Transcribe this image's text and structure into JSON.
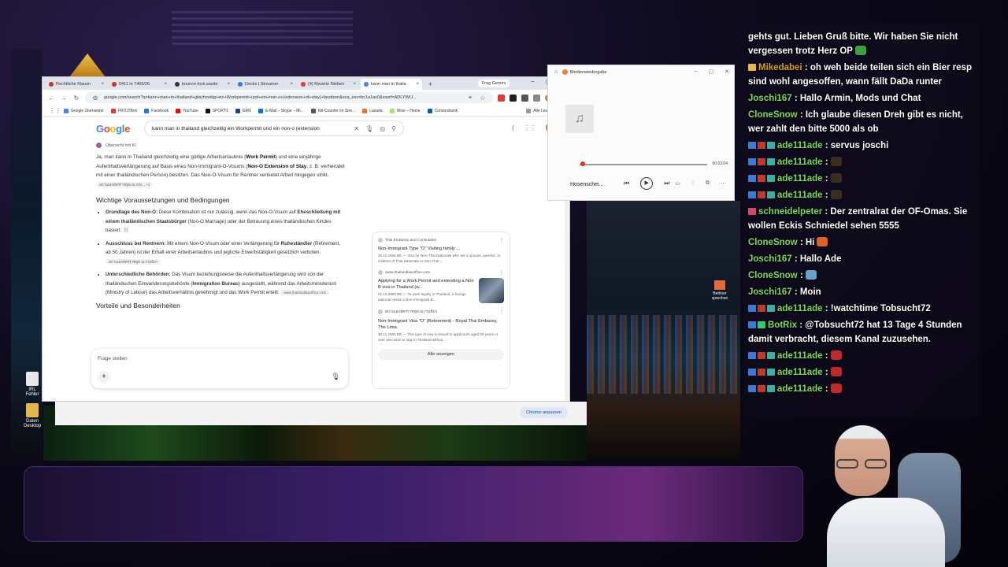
{
  "browser": {
    "tabs": [
      {
        "label": "Rechtliche Klausn",
        "color": "#c0392b"
      },
      {
        "label": "0411 in 7465/26",
        "color": "#d93025"
      },
      {
        "label": "bounce-lock.waste",
        "color": "#333333"
      },
      {
        "label": "Decks | Streamer",
        "color": "#3a7bd5"
      },
      {
        "label": "(4) Reverie Nieben",
        "color": "#e53935"
      },
      {
        "label": "kann man in thaila",
        "color": "#4285f4",
        "active": true
      }
    ],
    "gemini_label": "Frag Gemini",
    "url": "google.com/search?q=kann+man+in+thailand+gleichzeitig+ein+Workpermit+und+ein+non-o+(extension+of+stay)+besitzen&sca_esv=bc1a1ac0&sxsrf=ADLYWIJ...",
    "bookmarks": [
      {
        "label": "Google Übersetzer",
        "color": "#4285f4"
      },
      {
        "label": "FRITZ!Box",
        "color": "#e53935"
      },
      {
        "label": "Facebook",
        "color": "#1877f2"
      },
      {
        "label": "YouTube",
        "color": "#ff0000"
      },
      {
        "label": "SPORT1",
        "color": "#111111"
      },
      {
        "label": "GMX",
        "color": "#1c449b"
      },
      {
        "label": "E-Mail – Skype – Mi...",
        "color": "#0078d4"
      },
      {
        "label": "Kill-Counter im Stre...",
        "color": "#555555"
      },
      {
        "label": "Lazada",
        "color": "#f57224"
      },
      {
        "label": "Wise – Home",
        "color": "#9fe870"
      },
      {
        "label": "Consorsbank",
        "color": "#0064b0"
      },
      {
        "label": "Alle Lesezeichen",
        "color": "#999999"
      }
    ],
    "search_query": "kann man in thailand gleichzeitig ein Workpermit und ein non-o (extension",
    "ai_overview_label": "Übersicht mit KI",
    "intro": {
      "p1": "Ja, man kann in Thailand gleichzeitig eine gültige Arbeitserlaubnis (",
      "b1": "Work Permit",
      "p2": ") und eine einjährige Aufenthaltsverlängerung auf Basis eines Non-Immigrant-O-Visums (",
      "b2": "Non-O Extension of Stay",
      "p3": ", z. B. verheiratet mit einer thailändischen Person) besitzen. Das Non-O-Visum für Rentner verbietet Arbeit hingegen strikt.",
      "chip": "สถานเอกอัครราชทูต ณ กรุง... +1"
    },
    "heading_conditions": "Wichtige Voraussetzungen und Bedingungen",
    "points": [
      {
        "bold": "Grundlage des Non-O:",
        "t1": " Diese Kombination ist nur zulässig, wenn das Non-O-Visum auf ",
        "b2": "Eheschließung mit einem thailändischen Staatsbürger",
        "t2": " (Non-O Marriage) oder der Betreuung eines thailändischen Kindes basiert.",
        "chip": ""
      },
      {
        "bold": "Ausschluss bei Rentnern:",
        "t1": " Mit einem Non-O-Visum oder einer Verlängerung für ",
        "b2": "Ruheständler",
        "t2": " (Retirement, ab 50 Jahren) ist der Erhalt einer Arbeitserlaubnis und jegliche Erwerbstätigkeit gesetzlich verboten.",
        "chip": "สถานเอกอัครราชทูต ณ กรุงลิมา"
      },
      {
        "bold": "Unterschiedliche Behörden:",
        "t1": " Das Visum beziehungsweise die Aufenthaltsverlängerung wird von der thailändischen Einwanderungsbehörde (",
        "b2": "Immigration Bureau",
        "t2": ") ausgestellt, während das Arbeitsministerium (Ministry of Labour) das Arbeitsverhältnis genehmigt und das Work Permit erteilt.",
        "chip": "www.thailandlawoffice.com"
      }
    ],
    "heading_advantages": "Vorteile und Besonderheiten",
    "ask_placeholder": "Frage stellen",
    "sources": [
      {
        "site": "Thai Embassy and Consulates",
        "title": "Non-Immigrant Type \"O\" Visiting family ...",
        "snippet": "30.11.2566 BE — Visa for Non-Thai Nationals who are a spouse, parents, or children of Thai Nationals or Non-Thai ..."
      },
      {
        "site": "www.thailandlawoffice.com",
        "title": "Applying for a Work Permit and extending a Non B visa in Thailand (w...",
        "snippet": "01.10.2568 BE — To work legally in Thailand, a foreign national needs a Non-Immigrant B..."
      },
      {
        "site": "สถานเอกอัครราชทูต ณ กรุงลิมา",
        "title": "Non-Immigrant Visa \"O\" (Retirement) - Royal Thai Embassy, The Lima.",
        "snippet": "30.11.2565 BE — This type of visa is issued to applicants aged 50 years or over who wish to stay in Thailand withou..."
      }
    ],
    "sources_all": "Alle anzeigen",
    "chrome_customize": "Chrome anpassen"
  },
  "media_player": {
    "title": "Medienwiedergabe",
    "time": "00:03:04",
    "song": "Hosenschei...",
    "progress": 0.02
  },
  "desktop": {
    "icons": [
      {
        "label": "IRL Fehler"
      },
      {
        "label": "Daten Desktop"
      }
    ],
    "berliner": "Berliner sprechen"
  },
  "chat": {
    "messages": [
      {
        "user": "",
        "text": "gehts gut. Lieben Gruß bitte. Wir haben Sie nicht vergessen trotz Herz OP",
        "color": "#ffffff",
        "badges": [],
        "emote": "#3aa040"
      },
      {
        "user": "Mikedabei",
        "text": ": oh weh beide teilen sich ein Bier resp sind wohl angesoffen, wann fällt DaDa runter",
        "color": "#d4a017",
        "badges": [
          "#e6b84a"
        ],
        "emote": ""
      },
      {
        "user": "Joschi167",
        "text": ": Hallo Armin, Mods und Chat",
        "color": "#7ed957",
        "badges": [],
        "emote": ""
      },
      {
        "user": "CloneSnow",
        "text": ": Ich glaube diesen Dreh gibt es nicht, wer zahlt den bitte 5000 als ob",
        "color": "#7ed957",
        "badges": [],
        "emote": ""
      },
      {
        "user": "ade111ade",
        "text": ": servus joschi",
        "color": "#7ed957",
        "badges": [
          "#3a7bd5",
          "#c0392b",
          "#3ab0a0"
        ],
        "emote": ""
      },
      {
        "user": "ade111ade",
        "text": ":",
        "color": "#7ed957",
        "badges": [
          "#3a7bd5",
          "#c0392b",
          "#3ab0a0"
        ],
        "emote": "#3a2e22"
      },
      {
        "user": "ade111ade",
        "text": ":",
        "color": "#7ed957",
        "badges": [
          "#3a7bd5",
          "#c0392b",
          "#3ab0a0"
        ],
        "emote": "#3a2e22"
      },
      {
        "user": "ade111ade",
        "text": ":",
        "color": "#7ed957",
        "badges": [
          "#3a7bd5",
          "#c0392b",
          "#3ab0a0"
        ],
        "emote": "#3a2e22"
      },
      {
        "user": "schneidelpeter",
        "text": ": Der zentralrat der OF-Omas. Sie wollen Eckis Schniedel sehen 5555",
        "color": "#7ed957",
        "badges": [
          "#d04a6a"
        ],
        "emote": ""
      },
      {
        "user": "CloneSnow",
        "text": ": Hi",
        "color": "#7ed957",
        "badges": [],
        "emote": "#e0602a"
      },
      {
        "user": "Joschi167",
        "text": ": Hallo Ade",
        "color": "#7ed957",
        "badges": [],
        "emote": ""
      },
      {
        "user": "CloneSnow",
        "text": ":",
        "color": "#7ed957",
        "badges": [],
        "emote": "#6aa0c8"
      },
      {
        "user": "Joschi167",
        "text": ": Moin",
        "color": "#7ed957",
        "badges": [],
        "emote": ""
      },
      {
        "user": "ade111ade",
        "text": ": !watchtime Tobsucht72",
        "color": "#7ed957",
        "badges": [
          "#3a7bd5",
          "#c0392b",
          "#3ab0a0"
        ],
        "emote": ""
      },
      {
        "user": "BotRix",
        "text": ": @Tobsucht72 hat 13 Tage 4 Stunden damit verbracht, diesem Kanal zuzusehen.",
        "color": "#7ed957",
        "badges": [
          "#3a7bd5",
          "#2ecc71"
        ],
        "emote": ""
      },
      {
        "user": "ade111ade",
        "text": ":",
        "color": "#7ed957",
        "badges": [
          "#3a7bd5",
          "#c0392b",
          "#3ab0a0"
        ],
        "emote": "#c0282a"
      },
      {
        "user": "ade111ade",
        "text": ":",
        "color": "#7ed957",
        "badges": [
          "#3a7bd5",
          "#c0392b",
          "#3ab0a0"
        ],
        "emote": "#c0282a"
      },
      {
        "user": "ade111ade",
        "text": ":",
        "color": "#7ed957",
        "badges": [
          "#3a7bd5",
          "#c0392b",
          "#3ab0a0"
        ],
        "emote": "#c0282a"
      }
    ]
  }
}
